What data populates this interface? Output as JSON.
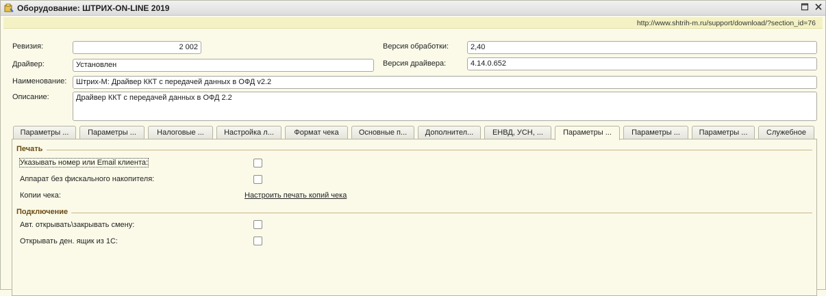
{
  "window": {
    "title": "Оборудование: ШТРИХ-ON-LINE 2019",
    "url": "http://www.shtrih-m.ru/support/download/?section_id=76"
  },
  "form": {
    "revision_label": "Ревизия:",
    "revision_value": "2 002",
    "processing_version_label": "Версия обработки:",
    "processing_version_value": "2,40",
    "driver_label": "Драйвер:",
    "driver_value": "Установлен",
    "driver_version_label": "Версия драйвера:",
    "driver_version_value": "4.14.0.652",
    "name_label": "Наименование:",
    "name_value": "Штрих-М: Драйвер ККТ с передачей данных в ОФД v2.2",
    "description_label": "Описание:",
    "description_value": "Драйвер ККТ с передачей данных в ОФД 2.2"
  },
  "tabs": [
    "Параметры ...",
    "Параметры ...",
    "Налоговые ...",
    "Настройка л...",
    "Формат чека",
    "Основные п...",
    "Дополнител...",
    "ЕНВД, УСН, ...",
    "Параметры ...",
    "Параметры ...",
    "Параметры ...",
    "Служебное"
  ],
  "active_tab_index": 8,
  "print_group": {
    "title": "Печать",
    "customer_contact_label": "Указывать номер или Email клиента:",
    "customer_contact_checked": false,
    "no_fiscal_storage_label": "Аппарат без фискального накопителя:",
    "no_fiscal_storage_checked": false,
    "receipt_copies_label": "Копии чека:",
    "receipt_copies_link": "Настроить печать копий чека"
  },
  "connection_group": {
    "title": "Подключение",
    "auto_shift_label": "Авт. открывать\\закрывать смену:",
    "auto_shift_checked": false,
    "cash_drawer_label": "Открывать ден. ящик из 1С:",
    "cash_drawer_checked": false
  }
}
